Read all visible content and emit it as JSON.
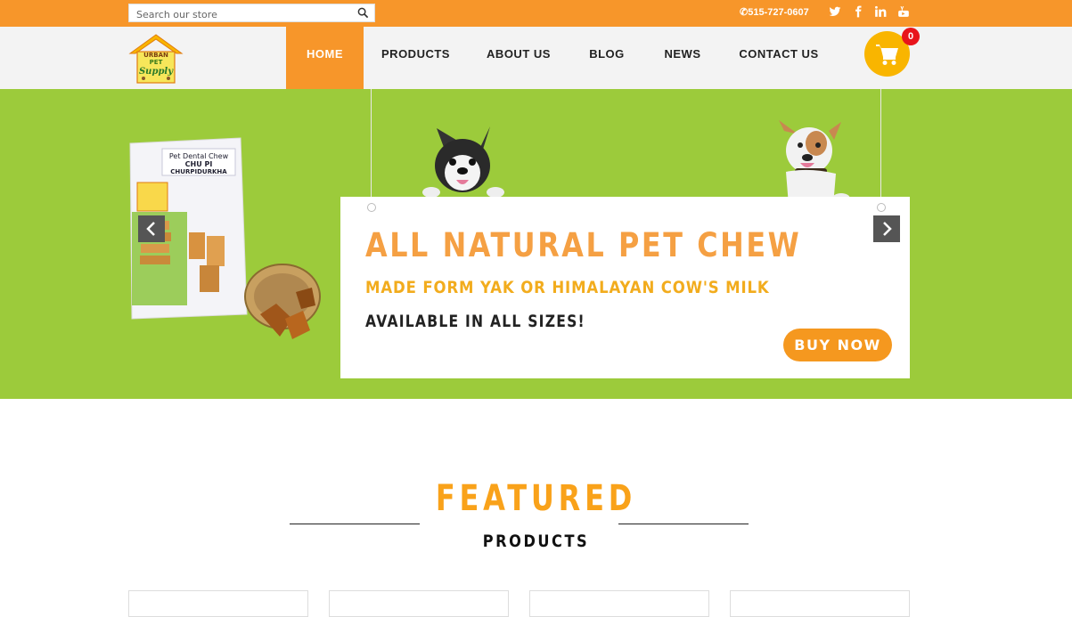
{
  "search": {
    "placeholder": "Search our store"
  },
  "topbar": {
    "phone": "515-727-0607"
  },
  "social": [
    "twitter-icon",
    "facebook-icon",
    "linkedin-icon",
    "youtube-icon"
  ],
  "logo": {
    "line1": "URBAN",
    "line2": "PET",
    "line3": "Supply"
  },
  "nav": {
    "items": [
      {
        "label": "HOME",
        "active": true
      },
      {
        "label": "PRODUCTS",
        "active": false
      },
      {
        "label": "ABOUT US",
        "active": false
      },
      {
        "label": "BLOG",
        "active": false
      },
      {
        "label": "NEWS",
        "active": false
      },
      {
        "label": "CONTACT US",
        "active": false
      }
    ]
  },
  "cart": {
    "count": "0"
  },
  "hero": {
    "title": "ALL NATURAL PET CHEW",
    "subtitle": "MADE FORM YAK OR HIMALAYAN COW'S MILK",
    "availability": "AVAILABLE IN ALL SIZES!",
    "button": "BUY NOW",
    "package_label": "Pet Dental Chew CHU PI CHURPIDURKHA"
  },
  "section": {
    "title": "FEATURED",
    "subtitle": "PRODUCTS"
  },
  "colors": {
    "accent": "#f7962a",
    "hero_bg": "#9ccb3b",
    "cart": "#f9b500",
    "badge": "#e8141b"
  }
}
